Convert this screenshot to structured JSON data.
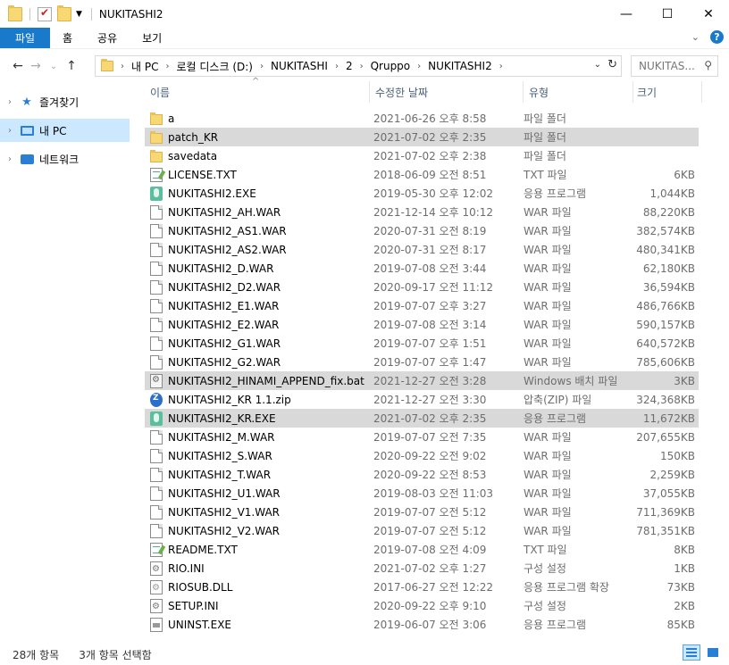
{
  "window": {
    "title": "NUKITASHI2"
  },
  "ribbon": {
    "tabs": [
      "파일",
      "홈",
      "공유",
      "보기"
    ]
  },
  "address": {
    "crumbs": [
      "내 PC",
      "로컬 디스크 (D:)",
      "NUKITASHI",
      "2",
      "Qruppo",
      "NUKITASHI2"
    ]
  },
  "search": {
    "placeholder": "NUKITAS..."
  },
  "navpane": {
    "items": [
      {
        "label": "즐겨찾기",
        "icon": "star-icon"
      },
      {
        "label": "내 PC",
        "icon": "pc-icon"
      },
      {
        "label": "네트워크",
        "icon": "network-icon"
      }
    ]
  },
  "columns": {
    "name": "이름",
    "date": "수정한 날짜",
    "type": "유형",
    "size": "크기"
  },
  "files": [
    {
      "name": "a",
      "date": "2021-06-26 오후 8:58",
      "type": "파일 폴더",
      "size": "",
      "icon": "folder",
      "selected": false
    },
    {
      "name": "patch_KR",
      "date": "2021-07-02 오후 2:35",
      "type": "파일 폴더",
      "size": "",
      "icon": "folder",
      "selected": true
    },
    {
      "name": "savedata",
      "date": "2021-07-02 오후 2:38",
      "type": "파일 폴더",
      "size": "",
      "icon": "folder",
      "selected": false
    },
    {
      "name": "LICENSE.TXT",
      "date": "2018-06-09 오전 8:51",
      "type": "TXT 파일",
      "size": "6KB",
      "icon": "txt",
      "selected": false
    },
    {
      "name": "NUKITASHI2.EXE",
      "date": "2019-05-30 오후 12:02",
      "type": "응용 프로그램",
      "size": "1,044KB",
      "icon": "exe",
      "selected": false
    },
    {
      "name": "NUKITASHI2_AH.WAR",
      "date": "2021-12-14 오후 10:12",
      "type": "WAR 파일",
      "size": "88,220KB",
      "icon": "file",
      "selected": false
    },
    {
      "name": "NUKITASHI2_AS1.WAR",
      "date": "2020-07-31 오전 8:19",
      "type": "WAR 파일",
      "size": "382,574KB",
      "icon": "file",
      "selected": false
    },
    {
      "name": "NUKITASHI2_AS2.WAR",
      "date": "2020-07-31 오전 8:17",
      "type": "WAR 파일",
      "size": "480,341KB",
      "icon": "file",
      "selected": false
    },
    {
      "name": "NUKITASHI2_D.WAR",
      "date": "2019-07-08 오전 3:44",
      "type": "WAR 파일",
      "size": "62,180KB",
      "icon": "file",
      "selected": false
    },
    {
      "name": "NUKITASHI2_D2.WAR",
      "date": "2020-09-17 오전 11:12",
      "type": "WAR 파일",
      "size": "36,594KB",
      "icon": "file",
      "selected": false
    },
    {
      "name": "NUKITASHI2_E1.WAR",
      "date": "2019-07-07 오후 3:27",
      "type": "WAR 파일",
      "size": "486,766KB",
      "icon": "file",
      "selected": false
    },
    {
      "name": "NUKITASHI2_E2.WAR",
      "date": "2019-07-08 오전 3:14",
      "type": "WAR 파일",
      "size": "590,157KB",
      "icon": "file",
      "selected": false
    },
    {
      "name": "NUKITASHI2_G1.WAR",
      "date": "2019-07-07 오후 1:51",
      "type": "WAR 파일",
      "size": "640,572KB",
      "icon": "file",
      "selected": false
    },
    {
      "name": "NUKITASHI2_G2.WAR",
      "date": "2019-07-07 오후 1:47",
      "type": "WAR 파일",
      "size": "785,606KB",
      "icon": "file",
      "selected": false
    },
    {
      "name": "NUKITASHI2_HINAMI_APPEND_fix.bat",
      "date": "2021-12-27 오전 3:28",
      "type": "Windows 배치 파일",
      "size": "3KB",
      "icon": "bat",
      "selected": true
    },
    {
      "name": "NUKITASHI2_KR 1.1.zip",
      "date": "2021-12-27 오전 3:30",
      "type": "압축(ZIP) 파일",
      "size": "324,368KB",
      "icon": "zip",
      "selected": false
    },
    {
      "name": "NUKITASHI2_KR.EXE",
      "date": "2021-07-02 오후 2:35",
      "type": "응용 프로그램",
      "size": "11,672KB",
      "icon": "exe",
      "selected": true
    },
    {
      "name": "NUKITASHI2_M.WAR",
      "date": "2019-07-07 오전 7:35",
      "type": "WAR 파일",
      "size": "207,655KB",
      "icon": "file",
      "selected": false
    },
    {
      "name": "NUKITASHI2_S.WAR",
      "date": "2020-09-22 오전 9:02",
      "type": "WAR 파일",
      "size": "150KB",
      "icon": "file",
      "selected": false
    },
    {
      "name": "NUKITASHI2_T.WAR",
      "date": "2020-09-22 오전 8:53",
      "type": "WAR 파일",
      "size": "2,259KB",
      "icon": "file",
      "selected": false
    },
    {
      "name": "NUKITASHI2_U1.WAR",
      "date": "2019-08-03 오전 11:03",
      "type": "WAR 파일",
      "size": "37,055KB",
      "icon": "file",
      "selected": false
    },
    {
      "name": "NUKITASHI2_V1.WAR",
      "date": "2019-07-07 오전 5:12",
      "type": "WAR 파일",
      "size": "711,369KB",
      "icon": "file",
      "selected": false
    },
    {
      "name": "NUKITASHI2_V2.WAR",
      "date": "2019-07-07 오전 5:12",
      "type": "WAR 파일",
      "size": "781,351KB",
      "icon": "file",
      "selected": false
    },
    {
      "name": "README.TXT",
      "date": "2019-07-08 오전 4:09",
      "type": "TXT 파일",
      "size": "8KB",
      "icon": "txt",
      "selected": false
    },
    {
      "name": "RIO.INI",
      "date": "2021-07-02 오후 1:27",
      "type": "구성 설정",
      "size": "1KB",
      "icon": "ini",
      "selected": false
    },
    {
      "name": "RIOSUB.DLL",
      "date": "2017-06-27 오전 12:22",
      "type": "응용 프로그램 확장",
      "size": "73KB",
      "icon": "dll",
      "selected": false
    },
    {
      "name": "SETUP.INI",
      "date": "2020-09-22 오후 9:10",
      "type": "구성 설정",
      "size": "2KB",
      "icon": "ini",
      "selected": false
    },
    {
      "name": "UNINST.EXE",
      "date": "2019-06-07 오전 3:06",
      "type": "응용 프로그램",
      "size": "85KB",
      "icon": "inst",
      "selected": false
    }
  ],
  "status": {
    "count": "28개 항목",
    "selected": "3개 항목 선택함"
  },
  "colors": {
    "accent": "#1979ca",
    "selection": "#cce8ff",
    "row_selected": "#d9d9d9"
  }
}
